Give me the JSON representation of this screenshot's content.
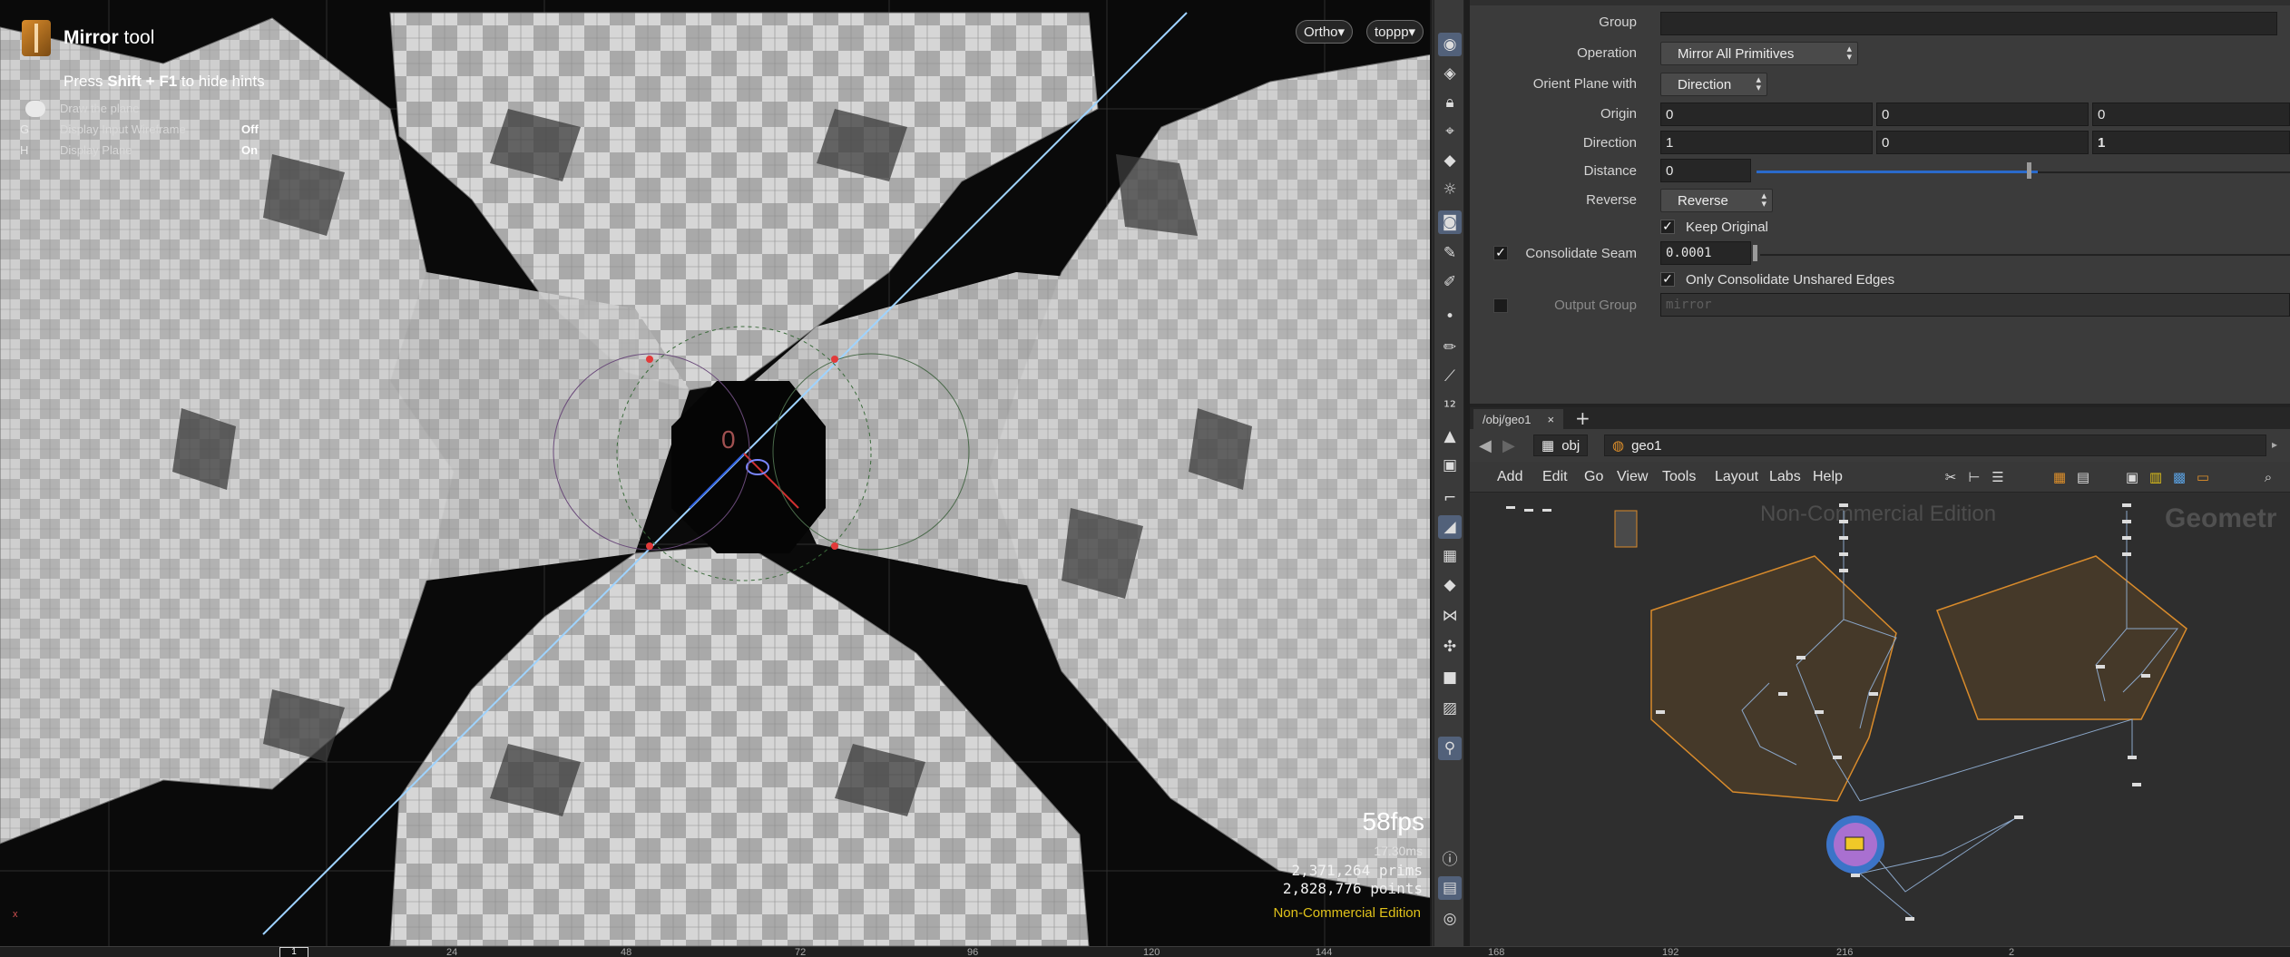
{
  "viewport": {
    "tool_name_bold": "Mirror",
    "tool_name_rest": " tool",
    "hint_prefix": "Press ",
    "hint_keys": "Shift + F1",
    "hint_suffix": " to hide hints",
    "hud_rows": [
      {
        "key": "",
        "label": "Draw the plane",
        "value": ""
      },
      {
        "key": "G",
        "label": "Display Input Wireframe",
        "value": "Off"
      },
      {
        "key": "H",
        "label": "Display Plane",
        "value": "On"
      }
    ],
    "ortho_btn": "Ortho",
    "camera_btn": "toppp",
    "fps": "58fps",
    "frame_time": "17.30ms",
    "prims": "2,371,264  prims",
    "points": "2,828,776 points",
    "non_commercial": "Non-Commercial Edition",
    "origin_label": "0",
    "handle_label": "0",
    "axis_label": "x"
  },
  "params": {
    "group": {
      "label": "Group",
      "value": ""
    },
    "operation": {
      "label": "Operation",
      "value": "Mirror All Primitives"
    },
    "orient_plane": {
      "label": "Orient Plane with",
      "value": "Direction"
    },
    "origin": {
      "label": "Origin",
      "values": [
        "0",
        "0",
        "0"
      ]
    },
    "direction": {
      "label": "Direction",
      "values": [
        "1",
        "0",
        "1"
      ]
    },
    "distance": {
      "label": "Distance",
      "value": "0"
    },
    "reverse": {
      "label": "Reverse",
      "value": "Reverse"
    },
    "keep_original": {
      "label": "Keep Original",
      "checked": true
    },
    "consolidate_seam": {
      "label": "Consolidate Seam",
      "value": "0.0001",
      "enabled": true
    },
    "only_consolidate": {
      "label": "Only Consolidate Unshared Edges",
      "checked": true
    },
    "output_group": {
      "label": "Output Group",
      "value": "mirror",
      "enabled": false
    }
  },
  "network": {
    "tab_label": "/obj/geo1",
    "tab_close": "×",
    "tab_add": "+",
    "crumb_obj": "obj",
    "crumb_geo": "geo1",
    "menus": [
      "Add",
      "Edit",
      "Go",
      "View",
      "Tools",
      "Layout",
      "Labs",
      "Help"
    ],
    "watermark": "Non-Commercial Edition",
    "context_label": "Geometr"
  },
  "timeline": {
    "current_frame": "1",
    "ticks": [
      "24",
      "48",
      "72",
      "96",
      "120",
      "144",
      "168",
      "192",
      "216",
      "2"
    ]
  },
  "colors": {
    "accent_blue": "#2a6acb",
    "node_orange": "#d98b2b",
    "warning_yellow": "#e0c21a"
  }
}
